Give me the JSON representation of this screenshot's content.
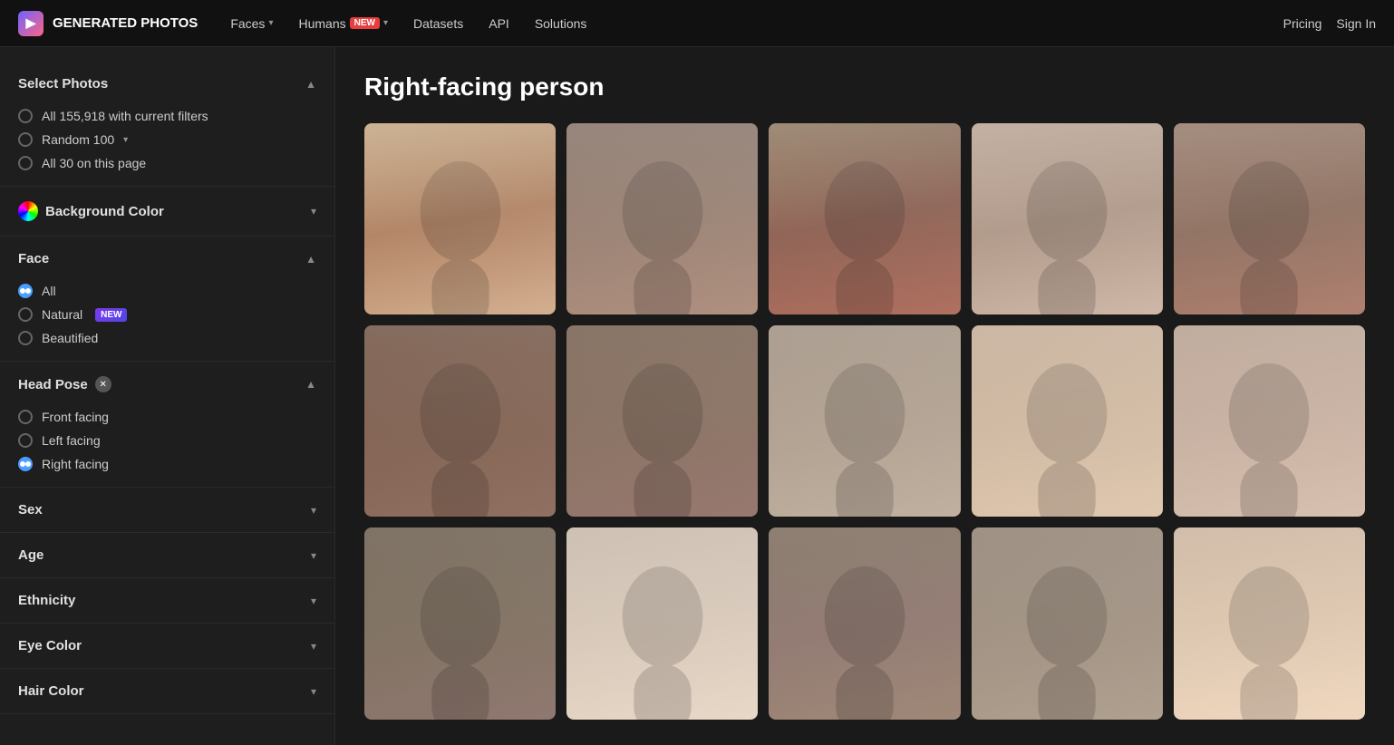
{
  "navbar": {
    "logo_text": "GENERATED PHOTOS",
    "nav_items": [
      {
        "label": "Faces",
        "has_dropdown": true,
        "badge": null
      },
      {
        "label": "Humans",
        "has_dropdown": true,
        "badge": "New"
      },
      {
        "label": "Datasets",
        "has_dropdown": false,
        "badge": null
      },
      {
        "label": "API",
        "has_dropdown": false,
        "badge": null
      },
      {
        "label": "Solutions",
        "has_dropdown": false,
        "badge": null
      }
    ],
    "pricing_label": "Pricing",
    "signin_label": "Sign In"
  },
  "sidebar": {
    "select_photos": {
      "title": "Select Photos",
      "options": [
        {
          "label": "All 155,918 with current filters",
          "checked": false
        },
        {
          "label": "Random 100",
          "checked": false,
          "has_dropdown": true
        },
        {
          "label": "All 30 on this page",
          "checked": false
        }
      ]
    },
    "background_color": {
      "title": "Background Color"
    },
    "face": {
      "title": "Face",
      "options": [
        {
          "label": "All",
          "checked": true
        },
        {
          "label": "Natural",
          "checked": false,
          "badge": "NEW"
        },
        {
          "label": "Beautified",
          "checked": false
        }
      ]
    },
    "head_pose": {
      "title": "Head Pose",
      "has_x": true,
      "options": [
        {
          "label": "Front facing",
          "checked": false
        },
        {
          "label": "Left facing",
          "checked": false
        },
        {
          "label": "Right facing",
          "checked": true
        }
      ]
    },
    "sex": {
      "title": "Sex"
    },
    "age": {
      "title": "Age"
    },
    "ethnicity": {
      "title": "Ethnicity"
    },
    "eye_color": {
      "title": "Eye Color"
    },
    "hair_color": {
      "title": "Hair Color"
    }
  },
  "main": {
    "title": "Right-facing person",
    "photos": [
      {
        "id": 1,
        "class": "face-1"
      },
      {
        "id": 2,
        "class": "face-2"
      },
      {
        "id": 3,
        "class": "face-3"
      },
      {
        "id": 4,
        "class": "face-4"
      },
      {
        "id": 5,
        "class": "face-5"
      },
      {
        "id": 6,
        "class": "face-6"
      },
      {
        "id": 7,
        "class": "face-7"
      },
      {
        "id": 8,
        "class": "face-8"
      },
      {
        "id": 9,
        "class": "face-9"
      },
      {
        "id": 10,
        "class": "face-10"
      },
      {
        "id": 11,
        "class": "face-11"
      },
      {
        "id": 12,
        "class": "face-12"
      },
      {
        "id": 13,
        "class": "face-13"
      },
      {
        "id": 14,
        "class": "face-14"
      },
      {
        "id": 15,
        "class": "face-15"
      }
    ]
  }
}
